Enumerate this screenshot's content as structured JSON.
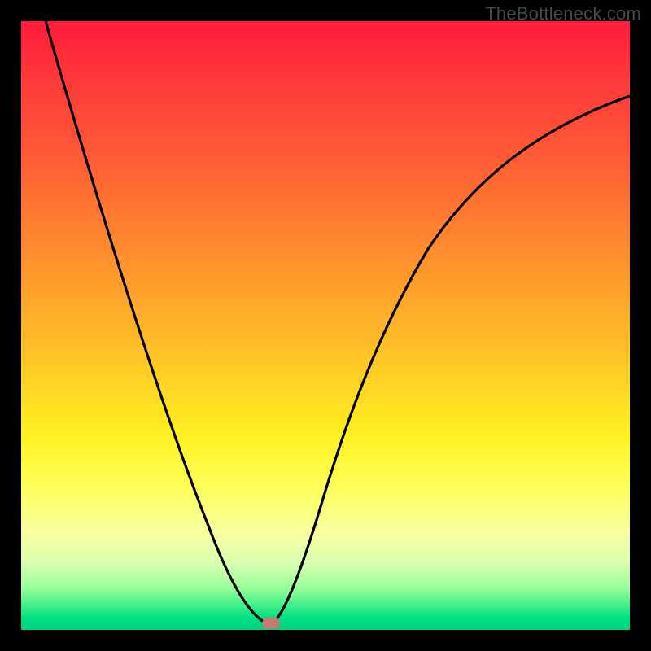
{
  "watermark": "TheBottleneck.com",
  "chart_data": {
    "type": "line",
    "title": "",
    "xlabel": "",
    "ylabel": "",
    "xlim": [
      0,
      100
    ],
    "ylim": [
      0,
      100
    ],
    "grid": false,
    "legend": false,
    "series": [
      {
        "name": "curve",
        "x": [
          4,
          8,
          12,
          16,
          20,
          24,
          28,
          32,
          36,
          40,
          41,
          44,
          48,
          52,
          56,
          60,
          64,
          70,
          78,
          88,
          100
        ],
        "y": [
          100,
          88,
          76,
          64,
          53,
          42,
          32,
          22,
          13,
          3,
          0.5,
          6,
          22,
          36,
          48,
          58,
          66,
          74,
          80,
          85,
          88
        ]
      }
    ],
    "marker": {
      "x": 41,
      "y": 0.5,
      "color": "#c77a74"
    },
    "gradient_stops": [
      {
        "pos": 0.0,
        "color": "#ff1c3b"
      },
      {
        "pos": 0.5,
        "color": "#ffba28"
      },
      {
        "pos": 0.8,
        "color": "#ffff55"
      },
      {
        "pos": 1.0,
        "color": "#00d07a"
      }
    ]
  }
}
